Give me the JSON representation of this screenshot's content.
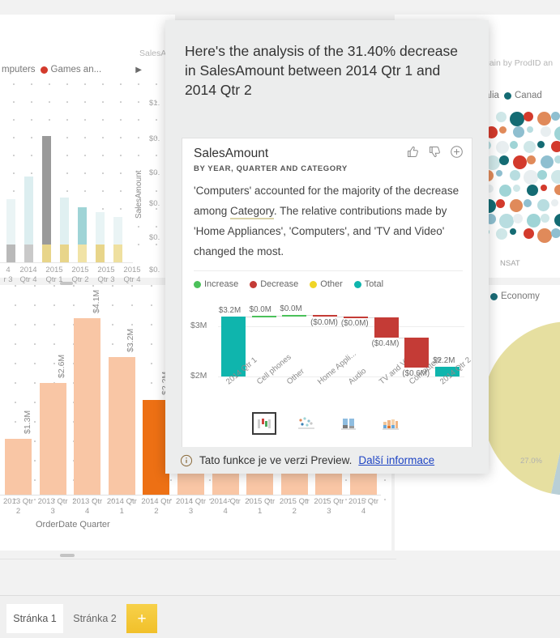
{
  "popup": {
    "headline": "Here's the analysis of the 31.40% decrease in SalesAmount between 2014 Qtr 1 and 2014 Qtr 2",
    "card": {
      "title": "SalesAmount",
      "subtitle": "BY YEAR, QUARTER AND CATEGORY",
      "body_part1": "'Computers' accounted for the majority of the decrease among ",
      "body_keyword": "Category",
      "body_part2": ". The relative contributions made by 'Home Appliances', 'Computers', and 'TV and Video' changed the most.",
      "icons": {
        "thumbs_up": "thumbs-up-icon",
        "thumbs_down": "thumbs-down-icon",
        "add": "plus-circle-icon"
      }
    },
    "chart_switcher": [
      {
        "name": "waterfall-chart-type",
        "label": "Waterfall",
        "active": true
      },
      {
        "name": "scatter-chart-type",
        "label": "Scatter",
        "active": false
      },
      {
        "name": "column-chart-type",
        "label": "Column",
        "active": false
      },
      {
        "name": "ribbon-chart-type",
        "label": "Ribbon",
        "active": false
      }
    ],
    "preview": {
      "text": "Tato funkce je ve verzi Preview.",
      "link": "Další informace",
      "icon": "info-icon"
    }
  },
  "chart_data": {
    "type": "bar",
    "title": "SalesAmount",
    "subtitle": "BY YEAR, QUARTER AND CATEGORY",
    "xlabel": "",
    "ylabel": "",
    "ylim": [
      2000000,
      3300000
    ],
    "yticks": [
      "$2M",
      "$3M"
    ],
    "grid": true,
    "legend_position": "top",
    "legend": [
      {
        "label": "Increase",
        "color": "#4bc15a"
      },
      {
        "label": "Decrease",
        "color": "#c43b36"
      },
      {
        "label": "Other",
        "color": "#f0d526"
      },
      {
        "label": "Total",
        "color": "#0fb5ad"
      }
    ],
    "categories": [
      "2014 Qtr 1",
      "Cell phones",
      "Other",
      "Home Appli...",
      "Audio",
      "TV and Video",
      "Computers",
      "2014 Qtr 2"
    ],
    "labels": [
      "$3.2M",
      "$0.0M",
      "$0.0M",
      "($0.0M)",
      "($0.0M)",
      "($0.4M)",
      "($0.6M)",
      "$2.2M"
    ],
    "kinds": [
      "total",
      "increase",
      "increase",
      "decrease",
      "decrease",
      "decrease",
      "decrease",
      "total"
    ],
    "values": [
      3200000,
      20000,
      10000,
      -20000,
      -30000,
      -400000,
      -600000,
      2200000
    ]
  },
  "background": {
    "top_left_visual": {
      "legend": [
        {
          "label": "mputers",
          "color": "#ffffff"
        },
        {
          "label": "Games an...",
          "color": "#d33a2c"
        }
      ],
      "expand_icon": "chevron-right-icon",
      "ylabel": "SalesAmount",
      "yticks": [
        "$1.",
        "$0.",
        "$0.",
        "$0.",
        "$0.",
        "$0."
      ],
      "xticks": [
        "4\n3",
        "2014\nQtr 4",
        "2015\nQtr 1",
        "2015\nQtr 2",
        "2015\nQtr 3",
        "2015\nQtr 4"
      ]
    },
    "top_right_visual": {
      "title": "Again by ProdID an",
      "legend": [
        {
          "label": "tralia",
          "color": "#9fd4d6"
        },
        {
          "label": "Canad",
          "color": "#146b73"
        }
      ],
      "axis_note": "NSAT",
      "legend2": [
        {
          "label": "Economy",
          "color": "#1a6b76"
        }
      ]
    },
    "bottom_left_visual": {
      "xlabel": "OrderDate Quarter",
      "bars": [
        {
          "label": "$1.3M",
          "x": "2013 Qtr\n2",
          "value": 1.3,
          "selected": false
        },
        {
          "label": "$2.6M",
          "x": "2013 Qtr\n3",
          "value": 2.6,
          "selected": false
        },
        {
          "label": "$4.1M",
          "x": "2013 Qtr\n4",
          "value": 4.1,
          "selected": false
        },
        {
          "label": "$3.2M",
          "x": "2014 Qtr\n1",
          "value": 3.2,
          "selected": false
        },
        {
          "label": "$2.2M",
          "x": "2014 Qtr\n2",
          "value": 2.2,
          "selected": true
        },
        {
          "label": "",
          "x": "2014 Qtr\n3",
          "value": 2.1,
          "selected": false
        },
        {
          "label": "",
          "x": "2014-Qtr\n4",
          "value": 2.1,
          "selected": false
        },
        {
          "label": "",
          "x": "2015 Qtr\n1",
          "value": 2.1,
          "selected": false
        },
        {
          "label": "",
          "x": "2015 Qtr\n2",
          "value": 2.1,
          "selected": false
        },
        {
          "label": "",
          "x": "2015 Qtr\n3",
          "value": 2.1,
          "selected": false
        },
        {
          "label": "",
          "x": "2015 Qtr\n4",
          "value": 2.1,
          "selected": false
        }
      ]
    }
  },
  "tabs": {
    "items": [
      {
        "label": "Stránka 1",
        "active": true
      },
      {
        "label": "Stránka 2",
        "active": false
      }
    ],
    "add_label": "+"
  }
}
